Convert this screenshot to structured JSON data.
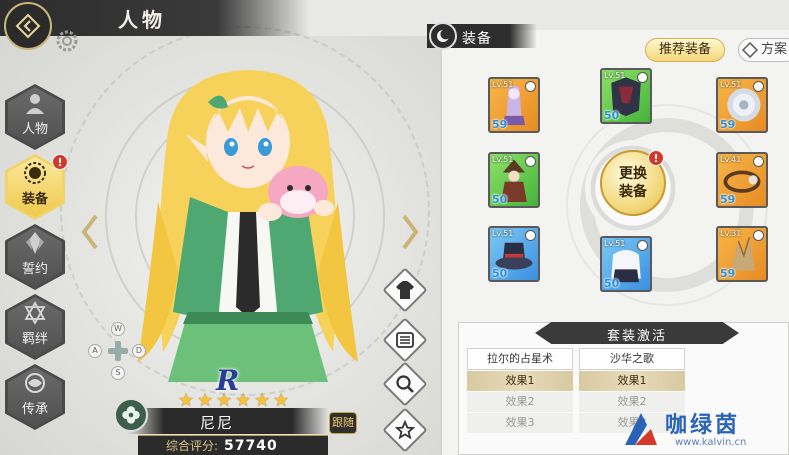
{
  "header": {
    "title": "人物"
  },
  "nav": {
    "items": [
      {
        "label": "人物",
        "icon": "profile-icon",
        "active": false
      },
      {
        "label": "装备",
        "icon": "sun-gear-icon",
        "active": true,
        "badge": "!"
      },
      {
        "label": "誓约",
        "icon": "crystal-icon",
        "active": false
      },
      {
        "label": "羁绊",
        "icon": "hexagram-icon",
        "active": false
      },
      {
        "label": "传承",
        "icon": "orb-icon",
        "active": false
      }
    ]
  },
  "dpad": {
    "up": "W",
    "left": "A",
    "right": "D",
    "down": "S"
  },
  "character": {
    "rarity": "R",
    "stars": 6,
    "name": "尼尼",
    "follow_label": "跟随",
    "score_label": "综合评分:",
    "score_value": "57740"
  },
  "tools": [
    "outfit-icon",
    "list-icon",
    "search-icon",
    "star-badge-icon"
  ],
  "equipment": {
    "tab_label": "装备",
    "recommend_label": "推荐装备",
    "plan_label": "方案",
    "swap_label": "更换装备",
    "swap_badge": "!",
    "slots": [
      {
        "id": "slot-1",
        "level": "Lv.51",
        "count": "59",
        "rarity": "orange",
        "icon": "girl-figure-icon"
      },
      {
        "id": "slot-2",
        "level": "Lv.51",
        "count": "50",
        "rarity": "green",
        "icon": "armor-icon"
      },
      {
        "id": "slot-3",
        "level": "Lv.51",
        "count": "59",
        "rarity": "orange",
        "icon": "shield-icon"
      },
      {
        "id": "slot-4",
        "level": "Lv.51",
        "count": "50",
        "rarity": "green",
        "icon": "mage-icon"
      },
      {
        "id": "slot-5",
        "level": "Lv.41",
        "count": "59",
        "rarity": "orange",
        "icon": "bracelet-icon"
      },
      {
        "id": "slot-6",
        "level": "Lv.51",
        "count": "50",
        "rarity": "blue",
        "icon": "hat-icon"
      },
      {
        "id": "slot-7",
        "level": "Lv.51",
        "count": "50",
        "rarity": "blue",
        "icon": "cloak-icon"
      },
      {
        "id": "slot-8",
        "level": "Lv.31",
        "count": "59",
        "rarity": "orange",
        "icon": "crystal-shard-icon"
      }
    ]
  },
  "set_bonus": {
    "title": "套装激活",
    "sets": [
      {
        "name": "拉尔的占星术",
        "effects": [
          "效果1",
          "效果2",
          "效果3"
        ],
        "active_count": 1
      },
      {
        "name": "沙华之歌",
        "effects": [
          "效果1",
          "效果2",
          "效果3"
        ],
        "active_count": 1
      }
    ]
  },
  "watermark": {
    "text": "咖绿茵",
    "url": "www.kalvin.cn"
  },
  "colors": {
    "accent_gold": "#f0c94a",
    "dark": "#2d2d2d",
    "alert": "#d33a2c"
  }
}
